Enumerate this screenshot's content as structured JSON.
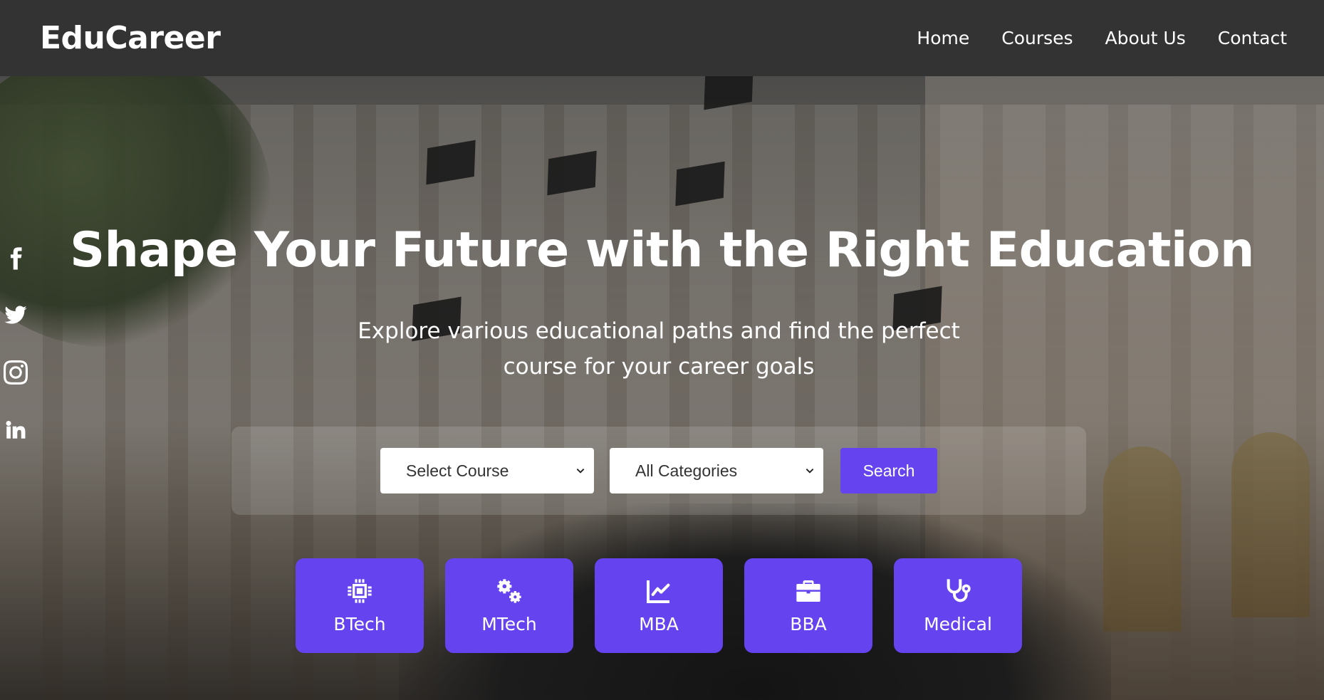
{
  "brand": "EduCareer",
  "nav": {
    "links": [
      "Home",
      "Courses",
      "About Us",
      "Contact"
    ]
  },
  "social": [
    "facebook-icon",
    "twitter-icon",
    "instagram-icon",
    "linkedin-icon"
  ],
  "hero": {
    "title": "Shape Your Future with the Right Education",
    "subtitle": "Explore various educational paths and find the perfect course for your career goals"
  },
  "search": {
    "course_select": "Select Course",
    "category_select": "All Categories",
    "button": "Search"
  },
  "categories": [
    {
      "label": "BTech",
      "icon": "chip-icon"
    },
    {
      "label": "MTech",
      "icon": "gears-icon"
    },
    {
      "label": "MBA",
      "icon": "chart-line-icon"
    },
    {
      "label": "BBA",
      "icon": "briefcase-icon"
    },
    {
      "label": "Medical",
      "icon": "stethoscope-icon"
    }
  ],
  "colors": {
    "accent": "#6544f0",
    "navbar": "#333333"
  }
}
